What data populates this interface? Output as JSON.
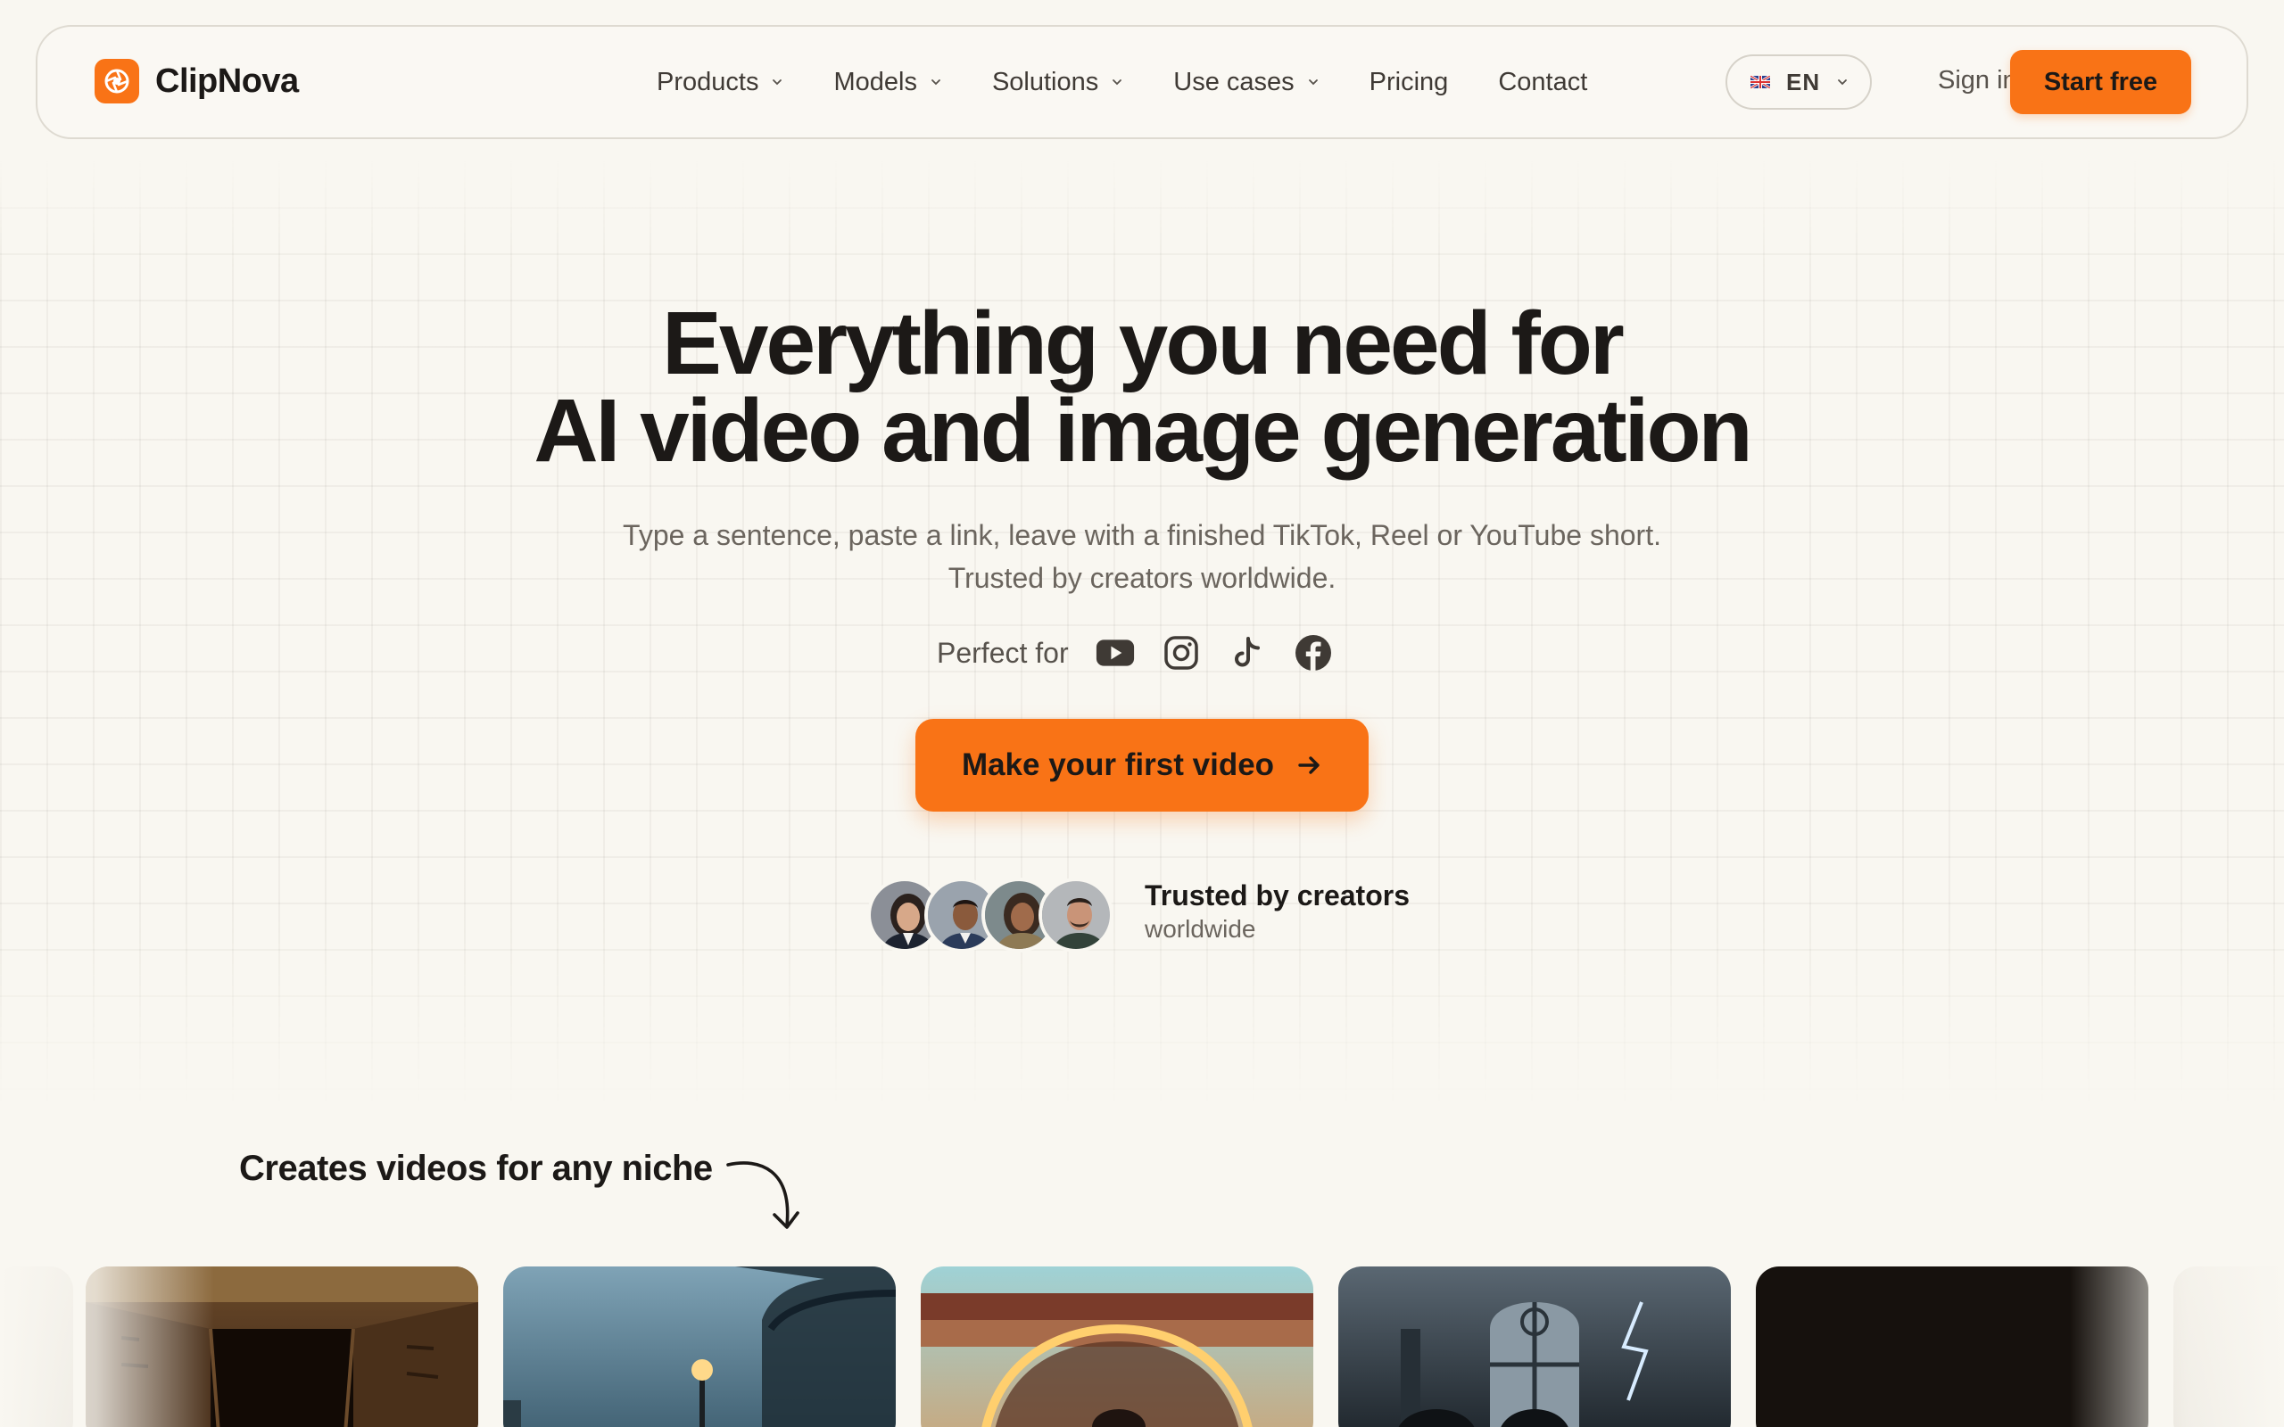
{
  "brand": {
    "name": "ClipNova",
    "accent": "#f97316"
  },
  "nav": {
    "items": [
      {
        "label": "Products",
        "has_dropdown": true
      },
      {
        "label": "Models",
        "has_dropdown": true
      },
      {
        "label": "Solutions",
        "has_dropdown": true
      },
      {
        "label": "Use cases",
        "has_dropdown": true
      },
      {
        "label": "Pricing",
        "has_dropdown": false
      },
      {
        "label": "Contact",
        "has_dropdown": false
      }
    ],
    "language": "EN",
    "signin_label": "Sign in",
    "start_label": "Start free"
  },
  "hero": {
    "headline_line1": "Everything you need for",
    "headline_line2": "AI video and image generation",
    "subtitle": "Type a sentence, paste a link, leave with a finished TikTok, Reel or YouTube short. Trusted by creators worldwide.",
    "perfect_for_label": "Perfect for",
    "platform_icons": [
      "youtube-icon",
      "instagram-icon",
      "tiktok-icon",
      "facebook-icon"
    ],
    "cta_label": "Make your first video",
    "trust_title": "Trusted by creators",
    "trust_sub": "worldwide"
  },
  "niche": {
    "title": "Creates videos for any niche",
    "cards": [
      "tomb-scene",
      "street-lamp-scene",
      "temple-glow-scene",
      "gothic-storm-scene",
      "dark-scene"
    ]
  }
}
